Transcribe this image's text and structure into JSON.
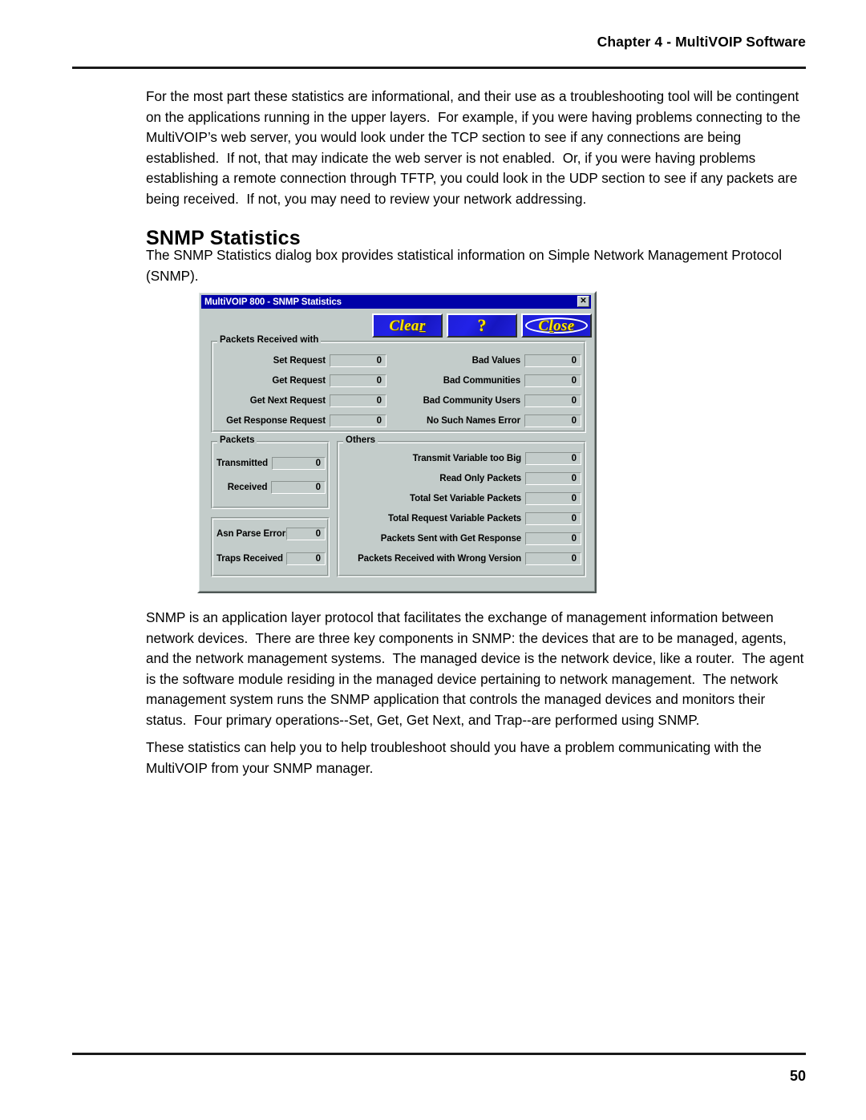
{
  "page": {
    "running_head": "Chapter 4 - MultiVOIP Software",
    "folio": "50"
  },
  "content": {
    "para_intro": "For the most part these statistics are informational, and their use as a troubleshooting tool will be contingent on the applications running in the upper layers.  For example, if you were having problems connecting to the MultiVOIP’s web server, you would look under the TCP section to see if any connections are being established.  If not, that may indicate the web server is not enabled.  Or, if you were having problems establishing a remote connection through TFTP, you could look in the UDP section to see if any packets are being received.  If not, you may need to review your network addressing.",
    "heading": "SNMP Statistics",
    "para_snmp_intro": "The SNMP Statistics dialog box provides statistical information on Simple Network Management Protocol (SNMP).",
    "para_snmp_desc": "SNMP is an application layer protocol that facilitates the exchange of management information between network devices.  There are three key components in SNMP: the devices that are to be managed, agents, and the network management systems.  The managed device is the network device, like a router.  The agent is the software module residing in the managed device pertaining to network management.  The network management system runs the SNMP application that controls the managed devices and monitors their status.  Four primary operations--Set, Get, Get Next, and Trap--are performed using SNMP.",
    "para_snmp_help": "These statistics can help you to help troubleshoot should you have a problem communicating with the MultiVOIP from your SNMP manager."
  },
  "dialog": {
    "title": "MultiVOIP 800 - SNMP Statistics",
    "close_glyph": "✕",
    "colors": {
      "titlebar": "#0000a8",
      "face": "#c3ccca",
      "button_face": "#1f1fd8",
      "button_text": "#ffe600"
    },
    "toolbar": {
      "clear": {
        "pre": "Clea",
        "accel": "r",
        "post": ""
      },
      "help": {
        "glyph": "?"
      },
      "close": {
        "pre": "C",
        "accel": "l",
        "post": "ose"
      }
    },
    "groups": {
      "packets_received": {
        "title": "Packets Received with",
        "left_fields": [
          {
            "label": "Set Request",
            "value": "0"
          },
          {
            "label": "Get Request",
            "value": "0"
          },
          {
            "label": "Get Next Request",
            "value": "0"
          },
          {
            "label": "Get Response Request",
            "value": "0"
          }
        ],
        "right_fields": [
          {
            "label": "Bad Values",
            "value": "0"
          },
          {
            "label": "Bad Communities",
            "value": "0"
          },
          {
            "label": "Bad Community Users",
            "value": "0"
          },
          {
            "label": "No Such Names Error",
            "value": "0"
          }
        ]
      },
      "packets": {
        "title": "Packets",
        "fields": [
          {
            "label": "Transmitted",
            "value": "0"
          },
          {
            "label": "Received",
            "value": "0"
          }
        ]
      },
      "misc": {
        "title": "",
        "fields": [
          {
            "label": "Asn Parse Errors",
            "value": "0"
          },
          {
            "label": "Traps Received",
            "value": "0"
          }
        ]
      },
      "others": {
        "title": "Others",
        "fields": [
          {
            "label": "Transmit Variable too Big",
            "value": "0"
          },
          {
            "label": "Read Only Packets",
            "value": "0"
          },
          {
            "label": "Total Set Variable Packets",
            "value": "0"
          },
          {
            "label": "Total Request Variable Packets",
            "value": "0"
          },
          {
            "label": "Packets Sent with Get Response",
            "value": "0"
          },
          {
            "label": "Packets Received with Wrong Version",
            "value": "0"
          }
        ]
      }
    }
  }
}
